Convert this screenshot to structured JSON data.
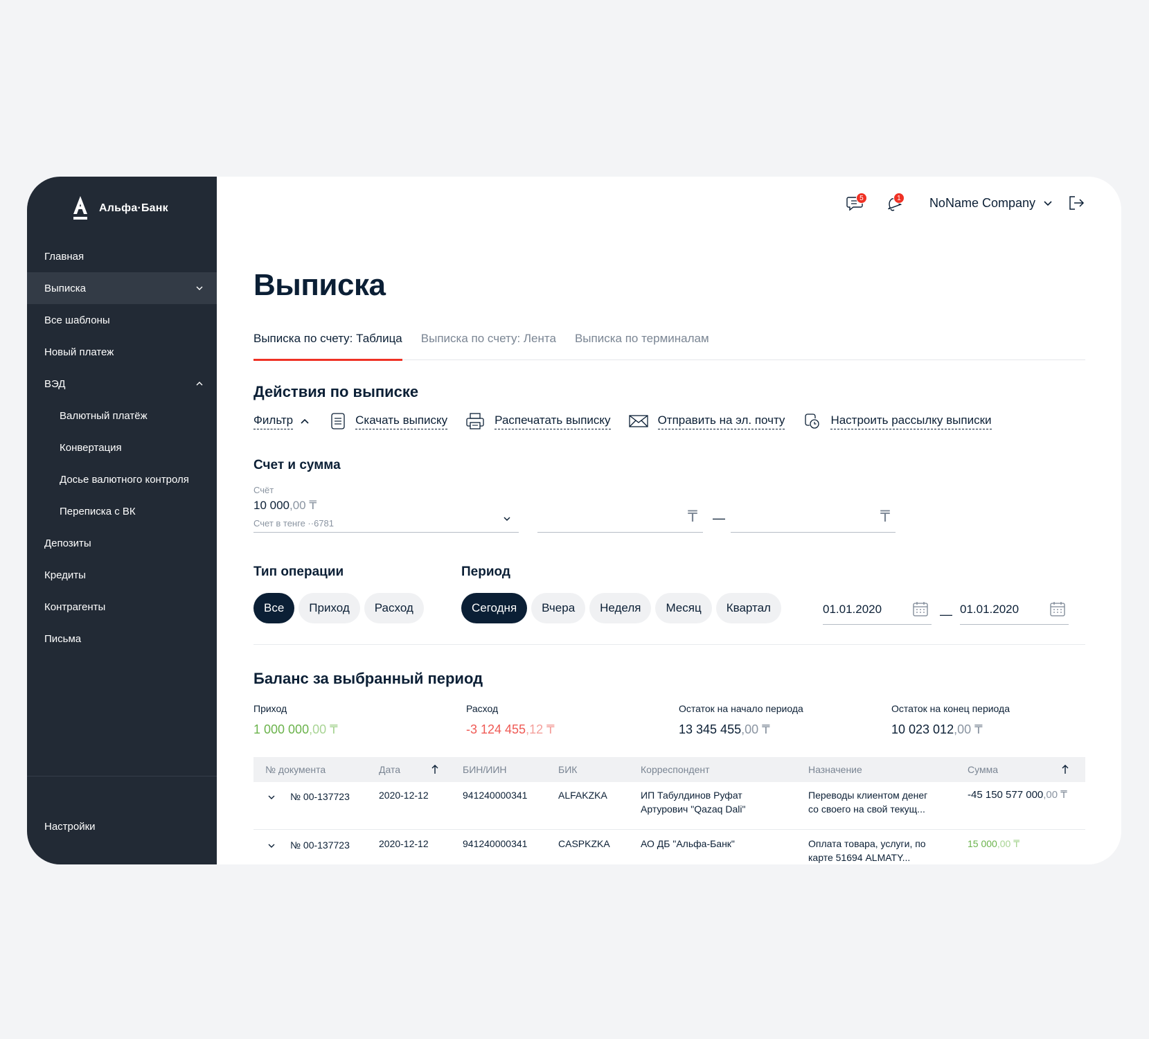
{
  "brand": {
    "name": "Альфа·Банк"
  },
  "sidebar": {
    "items": [
      {
        "label": "Главная"
      },
      {
        "label": "Выписка"
      },
      {
        "label": "Все шаблоны"
      },
      {
        "label": "Новый платеж"
      },
      {
        "label": "ВЭД"
      },
      {
        "label": "Валютный платёж"
      },
      {
        "label": "Конвертация"
      },
      {
        "label": "Досье валютного контроля"
      },
      {
        "label": "Переписка с ВК"
      },
      {
        "label": "Депозиты"
      },
      {
        "label": "Кредиты"
      },
      {
        "label": "Контрагенты"
      },
      {
        "label": "Письма"
      }
    ],
    "settings": "Настройки"
  },
  "topbar": {
    "messages_badge": "5",
    "notifications_badge": "1",
    "company": "NoName Company"
  },
  "page": {
    "title": "Выписка"
  },
  "tabs": [
    {
      "label": "Выписка по счету: Таблица"
    },
    {
      "label": "Выписка по счету: Лента"
    },
    {
      "label": "Выписка по терминалам"
    }
  ],
  "actions": {
    "title": "Действия по выписке",
    "filter": "Фильтр",
    "download": "Скачать выписку",
    "print": "Распечатать выписку",
    "email": "Отправить на эл. почту",
    "subscribe": "Настроить рассылку выписки"
  },
  "account": {
    "title": "Счет и сумма",
    "label": "Счёт",
    "amount_int": "10 000",
    "amount_dec": ",00",
    "currency": "₸",
    "sub": "Счет в тенге ··6781",
    "dash": "—"
  },
  "operation_type": {
    "title": "Тип операции",
    "options": [
      "Все",
      "Приход",
      "Расход"
    ]
  },
  "period": {
    "title": "Период",
    "options": [
      "Сегодня",
      "Вчера",
      "Неделя",
      "Месяц",
      "Квартал"
    ],
    "from": "01.01.2020",
    "to": "01.01.2020",
    "dash": "—"
  },
  "balance": {
    "title": "Баланс за выбранный период",
    "income_label": "Приход",
    "income_int": "1 000 000",
    "income_dec": ",00",
    "expense_label": "Расход",
    "expense_int": "-3 124 455",
    "expense_dec": ",12",
    "start_label": "Остаток на начало периода",
    "start_int": "13 345 455",
    "start_dec": ",00",
    "end_label": "Остаток на конец периода",
    "end_int": "10 023 012",
    "end_dec": ",00",
    "currency": "₸"
  },
  "table": {
    "headers": [
      "№ документа",
      "Дата",
      "БИН/ИИН",
      "БИК",
      "Корреспондент",
      "Назначение",
      "Сумма"
    ],
    "rows": [
      {
        "doc": "№ 00-137723",
        "date": "2020-12-12",
        "bin": "941240000341",
        "bik": "ALFAKZKA",
        "corr1": "ИП Табулдинов Руфат",
        "corr2": "Артурович \"Qazaq Dali\"",
        "purpose1": "Переводы клиентом денег",
        "purpose2": "со своего на свой текущ...",
        "sum_int": "-45 150 577 000",
        "sum_dec": ",00",
        "currency": "₸"
      },
      {
        "doc": "№ 00-137723",
        "date": "2020-12-12",
        "bin": "941240000341",
        "bik": "CASPKZKA",
        "corr1": "АО ДБ \"Альфа-Банк\"",
        "corr2": "",
        "purpose1": "Оплата товара, услуги, по",
        "purpose2": "карте 51694 ALMATY...",
        "sum_int": "15 000",
        "sum_dec": ",00",
        "currency": "₸"
      }
    ]
  },
  "colors": {
    "accent": "#ef3124",
    "dark": "#0b1f35",
    "sidebar": "#222a35",
    "income": "#6bb34c",
    "expense": "#ef5a55"
  }
}
